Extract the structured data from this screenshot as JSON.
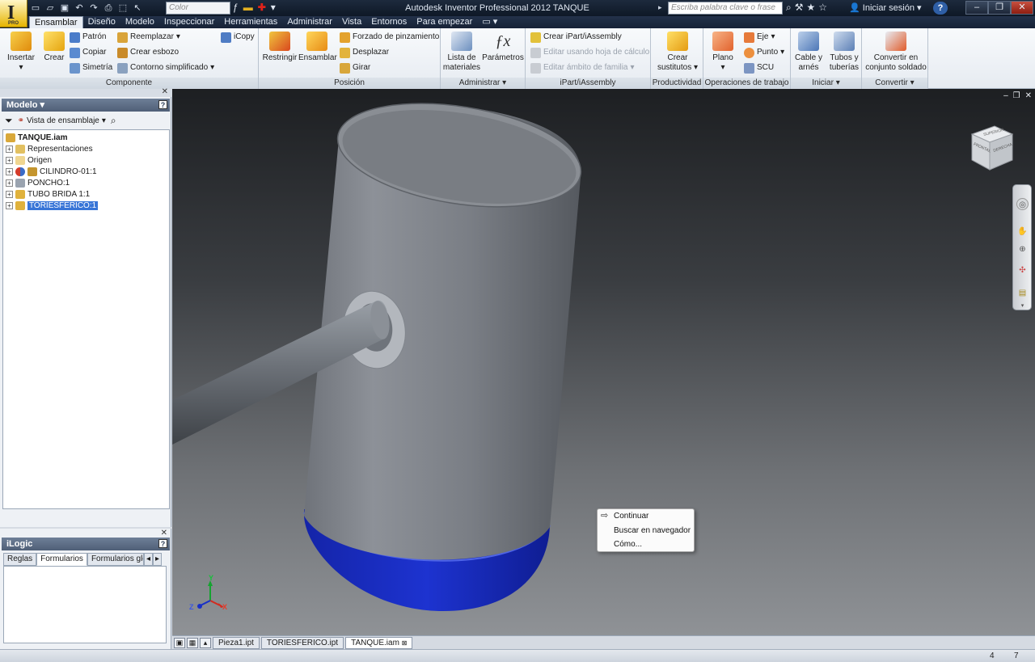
{
  "app": {
    "title": "Autodesk Inventor Professional 2012   TANQUE",
    "logo_badge": "PRO",
    "color_combo": "Color",
    "search_placeholder": "Escriba palabra clave o frase",
    "signin": "Iniciar sesión",
    "help": "?"
  },
  "tabs": [
    "Ensamblar",
    "Diseño",
    "Modelo",
    "Inspeccionar",
    "Herramientas",
    "Administrar",
    "Vista",
    "Entornos",
    "Para empezar"
  ],
  "ribbon": {
    "componente": {
      "label": "Componente",
      "insertar": "Insertar",
      "crear": "Crear",
      "patron": "Patrón",
      "copiar": "Copiar",
      "simetria": "Simetría",
      "reemplazar": "Reemplazar",
      "crear_esbozo": "Crear esbozo",
      "contorno": "Contorno simplificado",
      "icopy": "iCopy"
    },
    "posicion": {
      "label": "Posición",
      "restringir": "Restringir",
      "ensamblar": "Ensamblar",
      "forzado": "Forzado de pinzamiento",
      "desplazar": "Desplazar",
      "girar": "Girar"
    },
    "administrar": {
      "label": "Administrar",
      "lista1": "Lista de",
      "lista2": "materiales",
      "parametros": "Parámetros"
    },
    "ipart": {
      "label": "iPart/iAssembly",
      "crear": "Crear iPart/iAssembly",
      "editar_hoja": "Editar usando hoja de cálculo",
      "editar_ambito": "Editar ámbito de familia"
    },
    "productividad": {
      "label": "Productividad",
      "crear1": "Crear",
      "crear2": "sustitutos"
    },
    "operaciones": {
      "label": "Operaciones de trabajo",
      "plano": "Plano",
      "eje": "Eje",
      "punto": "Punto",
      "scu": "SCU"
    },
    "iniciar": {
      "label": "Iniciar",
      "cable1": "Cable y",
      "cable2": "arnés",
      "tubos1": "Tubos y",
      "tubos2": "tuberías"
    },
    "convertir": {
      "label": "Convertir",
      "conv1": "Convertir en",
      "conv2": "conjunto soldado"
    }
  },
  "browser": {
    "title": "Modelo",
    "view": "Vista de ensamblaje",
    "nodes": [
      "TANQUE.iam",
      "Representaciones",
      "Origen",
      "CILINDRO-01:1",
      "PONCHO:1",
      "TUBO BRIDA 1:1",
      "TORIESFERICO:1"
    ]
  },
  "ilogic": {
    "title": "iLogic",
    "tabs": [
      "Reglas",
      "Formularios",
      "Formularios glo"
    ]
  },
  "viewcube": {
    "front": "FRONTAL",
    "right": "DERECHA",
    "top": "SUPERIOR"
  },
  "context_menu": [
    "Continuar",
    "Buscar en navegador",
    "Cómo..."
  ],
  "axes": {
    "x": "X",
    "y": "Y",
    "z": "Z"
  },
  "doc_tabs": [
    "Pieza1.ipt",
    "TORIESFERICO.ipt",
    "TANQUE.iam"
  ],
  "status": {
    "a": "4",
    "b": "7"
  },
  "colors": {
    "accent": "#3875d7",
    "toriesferico": "#1226b8",
    "titlebar": "#172236"
  }
}
